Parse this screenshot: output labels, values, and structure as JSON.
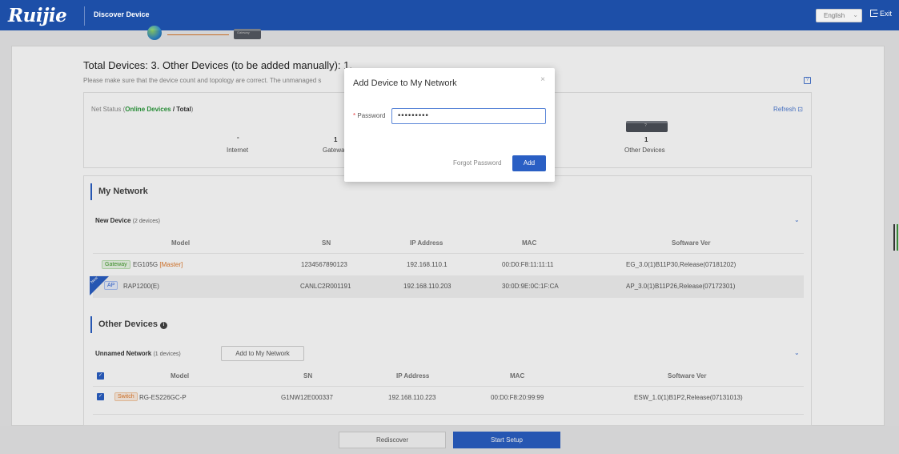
{
  "header": {
    "logo": "Ruijie",
    "title": "Discover Device",
    "language": "English",
    "exit_label": "Exit"
  },
  "summary": {
    "heading": "Total Devices: 3. Other Devices (to be added manually): 1.",
    "hint": "Please make sure that the device count and topology are correct. The unmanaged s"
  },
  "topology": {
    "status_prefix": "Net Status (",
    "status_online": "Online Devices",
    "status_sep": " / Total",
    "status_suffix": ")",
    "refresh_label": "Refresh",
    "internet_value": "-",
    "internet_label": "Internet",
    "gateway_value": "1",
    "gateway_label": "Gatewa",
    "gateway_device_text": "Gateway",
    "other_value": "1",
    "other_label": "Other Devices",
    "other_device_text": "?"
  },
  "my_network": {
    "title": "My Network",
    "new_device_label": "New Device",
    "new_device_count": "(2 devices)",
    "columns": [
      "Model",
      "SN",
      "IP Address",
      "MAC",
      "Software Ver"
    ],
    "rows": [
      {
        "tag": "Gateway",
        "model": "EG105G",
        "extra": "[Master]",
        "sn": "1234567890123",
        "ip": "192.168.110.1",
        "mac": "00:D0:F8:11:11:11",
        "ver": "EG_3.0(1)B11P30,Release(07181202)"
      },
      {
        "tag": "AP",
        "model": "RAP1200(E)",
        "extra": "",
        "sn": "CANLC2R001191",
        "ip": "192.168.110.203",
        "mac": "30:0D:9E:0C:1F:CA",
        "ver": "AP_3.0(1)B11P26,Release(07172301)",
        "corner": "New"
      }
    ]
  },
  "other_devices": {
    "title": "Other Devices",
    "unnamed_label": "Unnamed Network",
    "unnamed_count": "(1 devices)",
    "add_button": "Add to My Network",
    "columns": [
      "Model",
      "SN",
      "IP Address",
      "MAC",
      "Software Ver"
    ],
    "rows": [
      {
        "tag": "Switch",
        "model": "RG-ES226GC-P",
        "sn": "G1NW12E000337",
        "ip": "192.168.110.223",
        "mac": "00:D0:F8:20:99:99",
        "ver": "ESW_1.0(1)B1P2,Release(07131013)"
      }
    ]
  },
  "footer": {
    "rediscover": "Rediscover",
    "start_setup": "Start Setup"
  },
  "modal": {
    "title": "Add Device to My Network",
    "close": "×",
    "password_label": "Password",
    "required_mark": "*",
    "password_value": "•••••••••",
    "forgot_label": "Forgot Password",
    "add_button": "Add"
  },
  "colors": {
    "header_bg": "#1d4fa8",
    "primary": "#2a5fc4",
    "online_green": "#2b9a3c"
  }
}
